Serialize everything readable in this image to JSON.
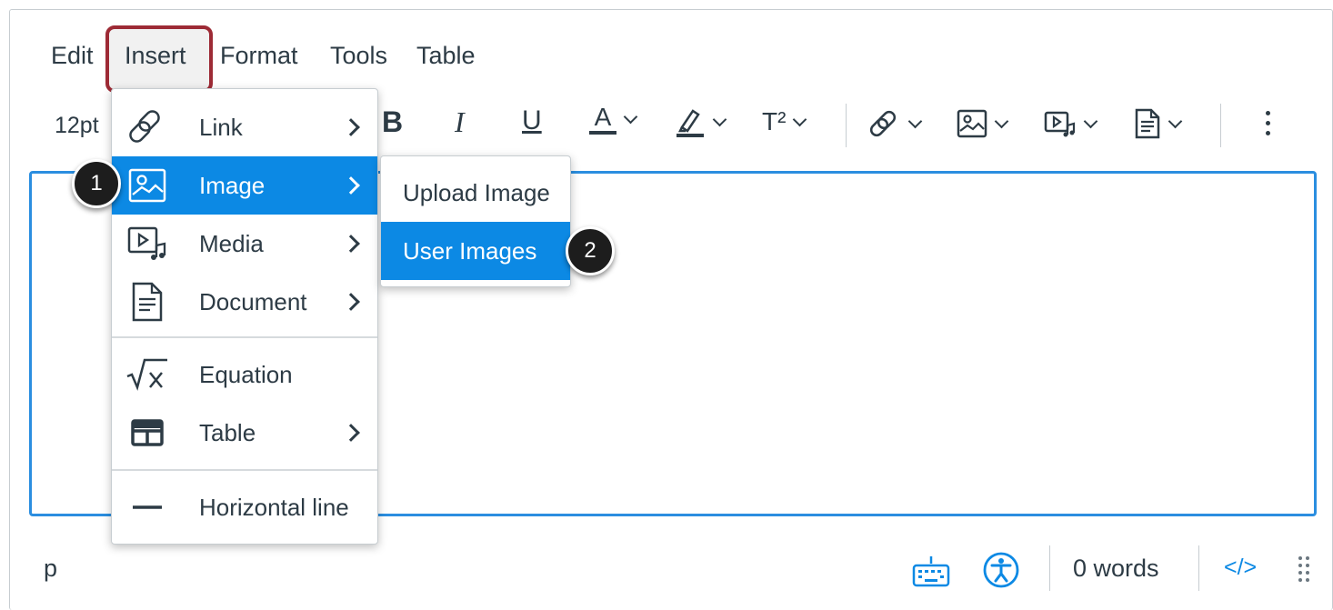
{
  "menubar": {
    "items": [
      {
        "label": "Edit"
      },
      {
        "label": "Insert"
      },
      {
        "label": "Format"
      },
      {
        "label": "Tools"
      },
      {
        "label": "Table"
      }
    ]
  },
  "toolbar": {
    "font_size": "12pt",
    "bold": "B",
    "italic": "I",
    "underline": "U",
    "text_color": "A",
    "superscript": "T²"
  },
  "insert_menu": {
    "items": [
      {
        "label": "Link",
        "icon": "link-icon",
        "has_submenu": true
      },
      {
        "label": "Image",
        "icon": "image-icon",
        "has_submenu": true,
        "active": true
      },
      {
        "label": "Media",
        "icon": "media-icon",
        "has_submenu": true
      },
      {
        "label": "Document",
        "icon": "document-icon",
        "has_submenu": true
      },
      {
        "label": "Equation",
        "icon": "equation-icon",
        "has_submenu": false
      },
      {
        "label": "Table",
        "icon": "table-icon",
        "has_submenu": true
      },
      {
        "label": "Horizontal line",
        "icon": "horizontal-line-icon",
        "has_submenu": false
      }
    ]
  },
  "image_submenu": {
    "items": [
      {
        "label": "Upload Image"
      },
      {
        "label": "User Images",
        "active": true
      }
    ]
  },
  "callouts": [
    "1",
    "2"
  ],
  "statusbar": {
    "element_path": "p",
    "word_count": "0 words",
    "html_toggle": "</>"
  },
  "colors": {
    "highlight_blue": "#0c89e4",
    "callout_outline": "#9d2a35",
    "editor_border": "#2b8ee0"
  }
}
